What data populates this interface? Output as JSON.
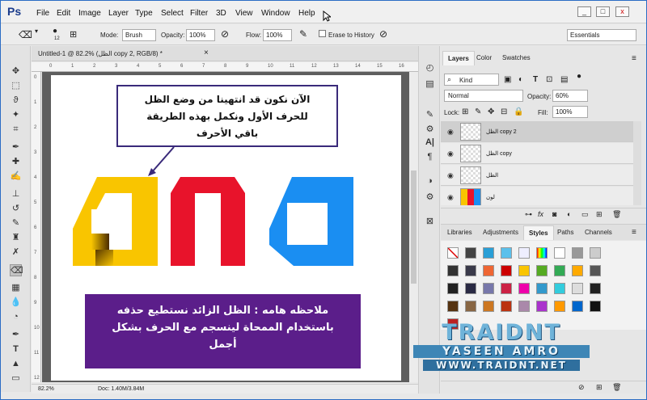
{
  "app": {
    "logo": "Ps"
  },
  "menu": [
    "File",
    "Edit",
    "Image",
    "Layer",
    "Type",
    "Select",
    "Filter",
    "3D",
    "View",
    "Window",
    "Help"
  ],
  "window_buttons": [
    "_",
    "□",
    "x"
  ],
  "options_bar": {
    "brush_size": "12",
    "mode_label": "Mode:",
    "mode_value": "Brush",
    "opacity_label": "Opacity:",
    "opacity_value": "100%",
    "flow_label": "Flow:",
    "flow_value": "100%",
    "erase_history_label": "Erase to History",
    "workspace": "Essentials"
  },
  "document": {
    "tab_title": "Untitled-1 @ 82.2% (الظل copy 2, RGB/8) *",
    "zoom": "82.2%",
    "doc_size": "Doc: 1.40M/3.84M"
  },
  "ruler_h_labels": [
    "0",
    "1",
    "2",
    "3",
    "4",
    "5",
    "6",
    "7",
    "8",
    "9",
    "10",
    "11",
    "12",
    "13",
    "14",
    "15",
    "16"
  ],
  "ruler_v_labels": [
    "0",
    "1",
    "2",
    "3",
    "4",
    "5",
    "6",
    "7",
    "8",
    "9",
    "10",
    "11",
    "12"
  ],
  "callout": {
    "line1": "الآن نكون قد انتهينا من وضع الظل",
    "line2": "للحرف الأول ونكمل بهذه الطريقة",
    "line3": "باقي الأحرف"
  },
  "note": {
    "line1": "ملاحظه هامه : الظل الزائد نستطيع حذفه",
    "line2": "باستخدام الممحاة لينسجم مع الحرف بشكل",
    "line3": "أجمل"
  },
  "art_colors": {
    "yellow": "#f9c500",
    "red": "#e8132b",
    "blue": "#1a8ef2"
  },
  "layers_panel": {
    "tabs": [
      "Layers",
      "Color",
      "Swatches"
    ],
    "filter": "Kind",
    "blend_mode": "Normal",
    "opacity_label": "Opacity:",
    "opacity_value": "60%",
    "lock_label": "Lock:",
    "fill_label": "Fill:",
    "fill_value": "100%",
    "layers": [
      {
        "name": "الظل copy 2",
        "selected": true
      },
      {
        "name": "الظل copy",
        "selected": false
      },
      {
        "name": "الظل",
        "selected": false
      },
      {
        "name": "لون",
        "selected": false
      }
    ]
  },
  "styles_panel": {
    "tabs": [
      "Libraries",
      "Adjustments",
      "Styles",
      "Paths",
      "Channels"
    ]
  },
  "watermark": {
    "brand": "TRAIDNT",
    "author": "YASEEN AMRO",
    "url": "WWW.TRAIDNT.NET"
  }
}
